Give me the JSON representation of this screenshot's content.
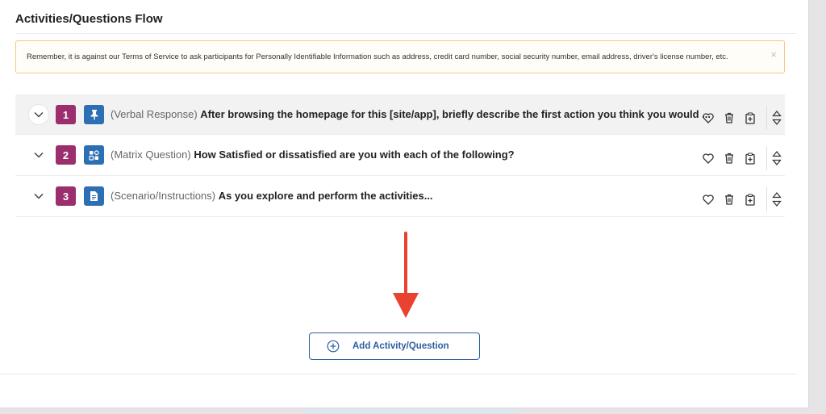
{
  "section": {
    "title": "Activities/Questions Flow"
  },
  "notice": {
    "text": "Remember, it is against our Terms of Service to ask participants for Personally Identifiable Information such as address, credit card number, social security number, email address, driver's license number, etc.",
    "close": "×"
  },
  "rows": [
    {
      "number": "1",
      "type": "(Verbal Response)",
      "title": "After browsing the homepage for this [site/app], briefly describe the first action you think you would ...",
      "icon": "pin-icon"
    },
    {
      "number": "2",
      "type": "(Matrix Question)",
      "title": "How Satisfied or dissatisfied are you with each of the following?",
      "icon": "matrix-icon"
    },
    {
      "number": "3",
      "type": "(Scenario/Instructions)",
      "title": "As you explore and perform the activities...",
      "icon": "document-icon"
    }
  ],
  "add_button": {
    "label": "Add Activity/Question",
    "icon": "plus-circle-icon"
  },
  "colors": {
    "badge": "#9b2f6d",
    "type_icon": "#2d6fb3",
    "primary": "#2d5fa0",
    "annotation_arrow": "#e8432e",
    "notice_border": "#f3c783"
  }
}
